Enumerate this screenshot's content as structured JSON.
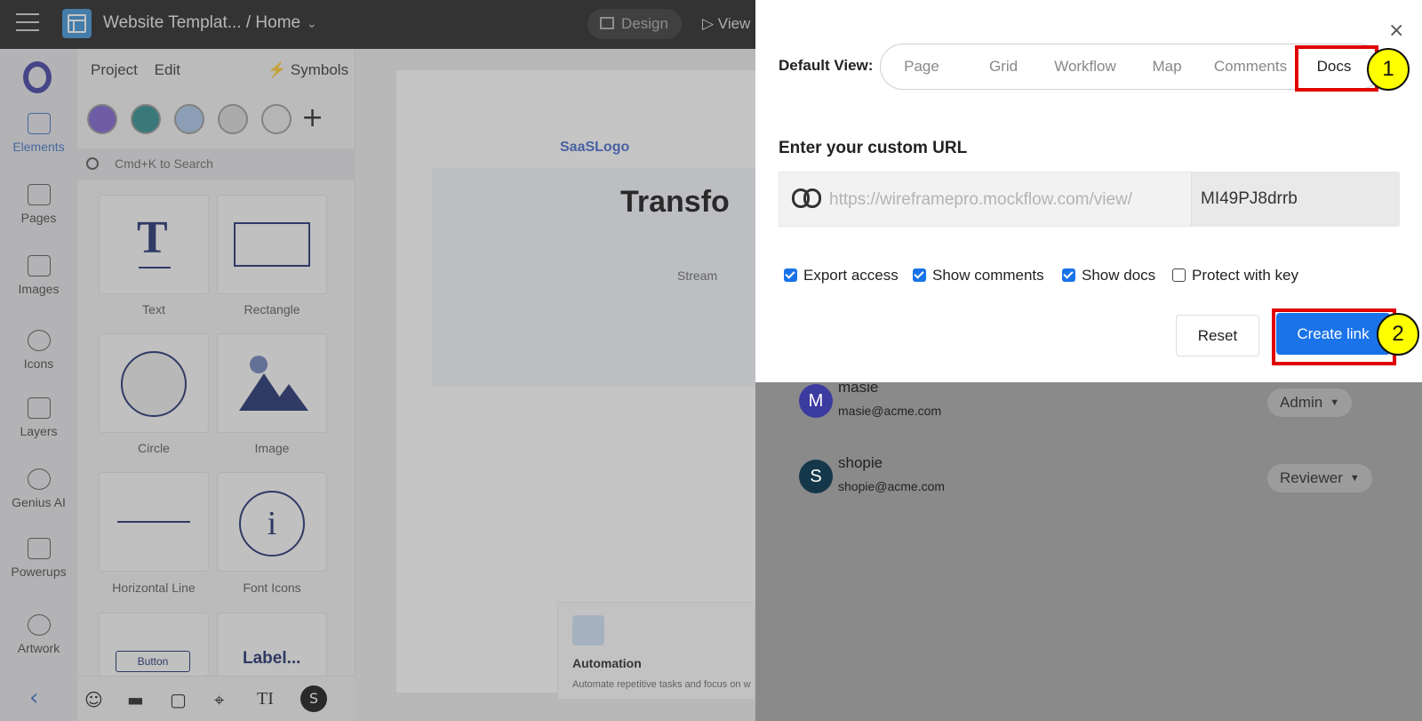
{
  "topbar": {
    "title": "Website Templat... / Home",
    "title_chevron": "⌄",
    "design_label": "Design",
    "view_label": "▷ View"
  },
  "rail": {
    "items": [
      {
        "label": "Elements"
      },
      {
        "label": "Pages"
      },
      {
        "label": "Images"
      },
      {
        "label": "Icons"
      },
      {
        "label": "Layers"
      },
      {
        "label": "Genius AI"
      },
      {
        "label": "Powerups"
      },
      {
        "label": "Artwork"
      }
    ],
    "back_glyph": "‹"
  },
  "panel": {
    "tab_project": "Project",
    "tab_edit": "Edit",
    "symbols": "⚡ Symbols",
    "add_glyph": "+",
    "search_placeholder": "Cmd+K to Search",
    "tiles": [
      {
        "label": "Text",
        "glyph": "T"
      },
      {
        "label": "Rectangle"
      },
      {
        "label": "Circle"
      },
      {
        "label": "Image"
      },
      {
        "label": "Horizontal Line"
      },
      {
        "label": "Font Icons",
        "glyph": "i"
      },
      {
        "label": "",
        "glyph": "Button"
      },
      {
        "label": "",
        "glyph": "Label..."
      }
    ],
    "more_glyph": "⋮",
    "tools": [
      "☺",
      "▬",
      "▢",
      "⌖",
      "TI",
      "S"
    ]
  },
  "canvas": {
    "logo": "SaaSLogo",
    "hero_title": "Transfo",
    "hero_sub": "Stream",
    "feature_title": "Automation",
    "feature_text": "Automate repetitive tasks and focus on w"
  },
  "members": [
    {
      "initial": "M",
      "name": "masie",
      "email": "masie@acme.com",
      "role": "Admin",
      "color": "#3b3ba0"
    },
    {
      "initial": "S",
      "name": "shopie",
      "email": "shopie@acme.com",
      "role": "Reviewer",
      "color": "#14384a"
    }
  ],
  "dialog": {
    "close_glyph": "×",
    "default_view_label": "Default View:",
    "views": [
      "Page",
      "Grid",
      "Workflow",
      "Map",
      "Comments",
      "Docs"
    ],
    "active_view": "Docs",
    "url_label": "Enter your custom URL",
    "url_prefix": "https://wireframepro.mockflow.com/view/",
    "url_value": "MI49PJ8drrb",
    "checkboxes": [
      {
        "label": "Export access",
        "checked": true
      },
      {
        "label": "Show comments",
        "checked": true
      },
      {
        "label": "Show docs",
        "checked": true
      },
      {
        "label": "Protect with key",
        "checked": false
      }
    ],
    "reset_label": "Reset",
    "create_label": "Create link"
  },
  "annotations": {
    "badge1": "1",
    "badge2": "2",
    "highlight_color": "#e00000",
    "badge_color": "#ffff00"
  },
  "colors": {
    "accent": "#1a73e8",
    "topbar": "#1f1f1f"
  }
}
